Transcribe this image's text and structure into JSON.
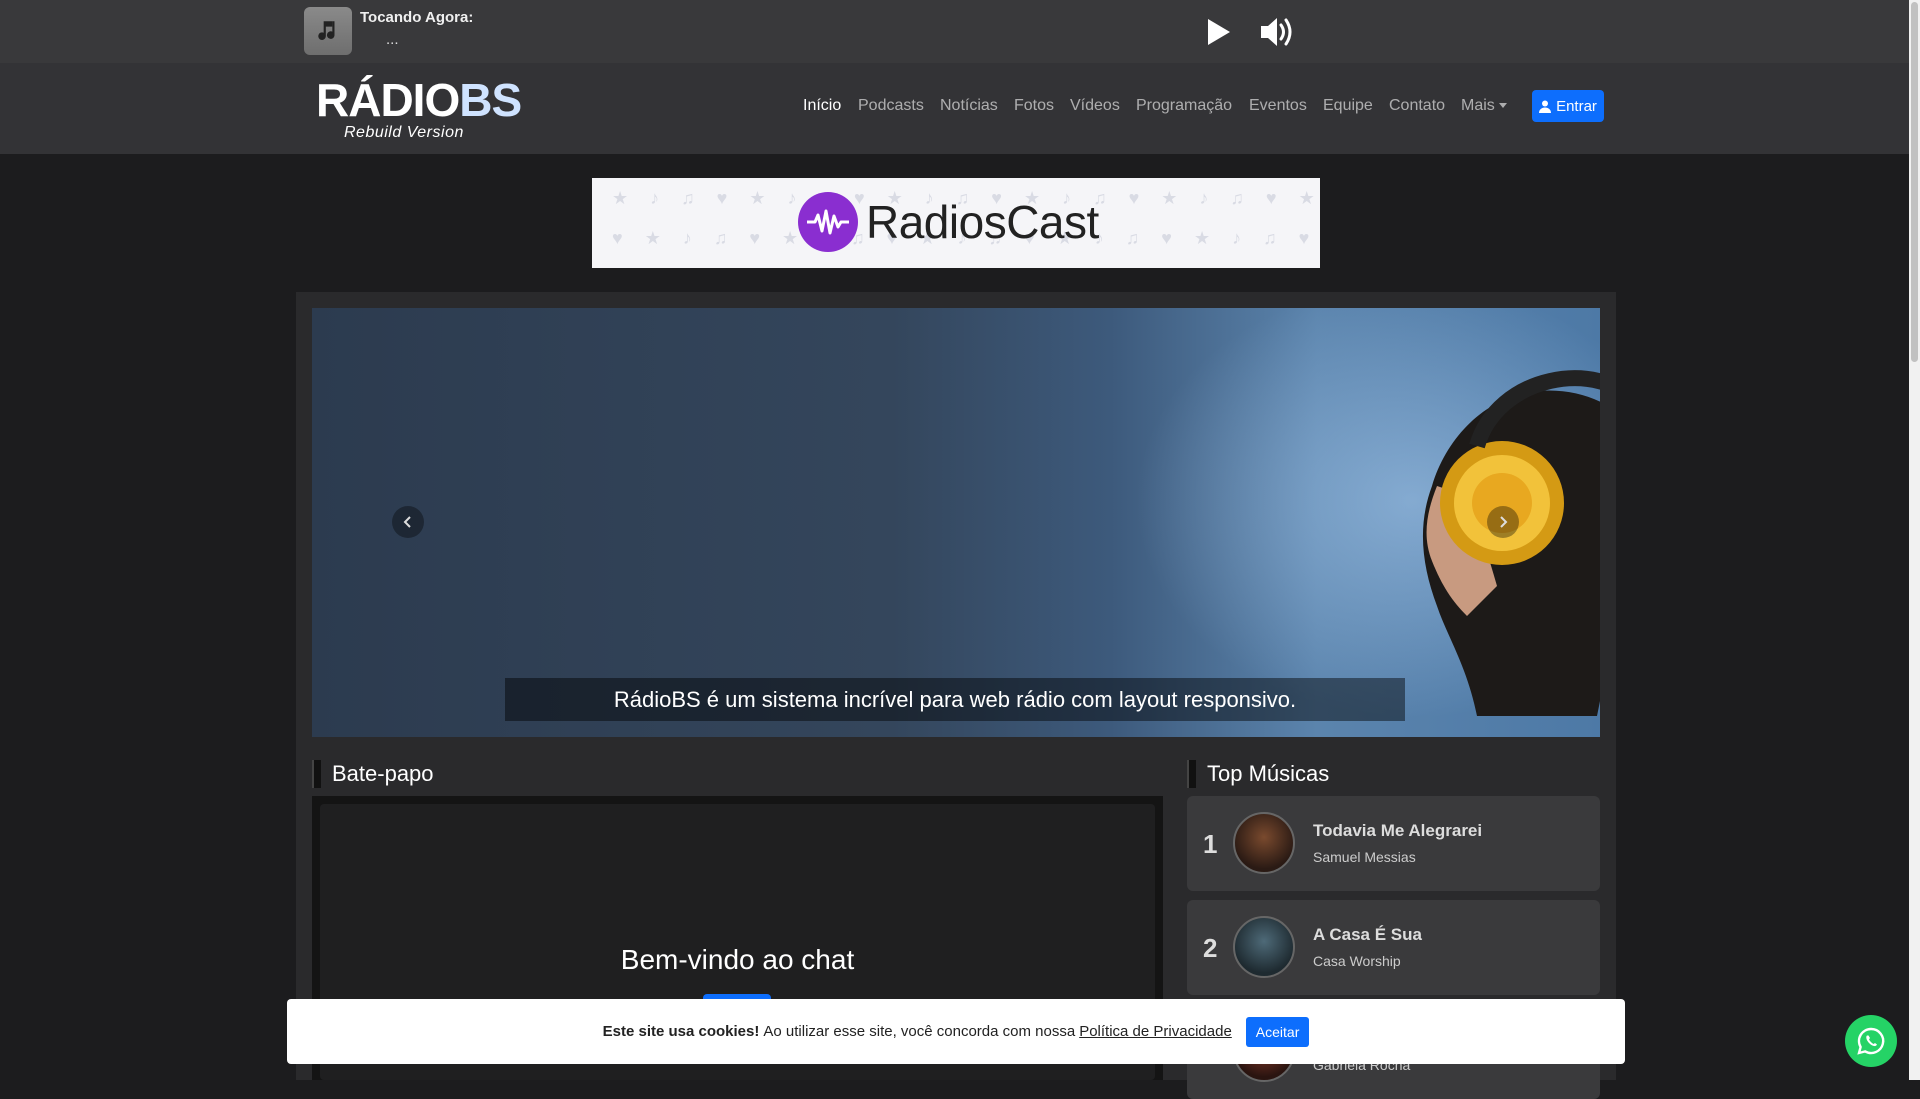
{
  "player": {
    "now_playing_label": "Tocando Agora:",
    "song": "...",
    "icons": [
      "music-note-icon",
      "play-icon",
      "volume-icon"
    ]
  },
  "navbar": {
    "logo_brand_part1": "RÁDIO",
    "logo_brand_part2": "BS",
    "logo_tagline": "Rebuild Version",
    "items": [
      {
        "label": "Início",
        "active": true
      },
      {
        "label": "Podcasts"
      },
      {
        "label": "Notícias"
      },
      {
        "label": "Fotos"
      },
      {
        "label": "Vídeos"
      },
      {
        "label": "Programação"
      },
      {
        "label": "Eventos"
      },
      {
        "label": "Equipe"
      },
      {
        "label": "Contato"
      },
      {
        "label": "Mais"
      }
    ],
    "login_label": "Entrar"
  },
  "ad": {
    "brand": "RadiosCast"
  },
  "slider": {
    "caption": "RádioBS é um sistema incrível para web rádio com layout responsivo."
  },
  "chat": {
    "title": "Bate-papo",
    "welcome": "Bem-vindo ao chat"
  },
  "top_songs": {
    "title": "Top Músicas",
    "items": [
      {
        "rank": "1",
        "name": "Todavia Me Alegrarei",
        "artist": "Samuel Messias"
      },
      {
        "rank": "2",
        "name": "A Casa É Sua",
        "artist": "Casa Worship"
      },
      {
        "rank": "3",
        "name": "",
        "artist": "Gabriela Rocha"
      }
    ]
  },
  "cookies": {
    "bold": "Este site usa cookies!",
    "text": "Ao utilizar esse site, você concorda com nossa",
    "link": "Política de Privacidade",
    "accept": "Aceitar"
  },
  "colors": {
    "primary": "#0d6efd",
    "background": "#1c1c1e",
    "whatsapp": "#25d366"
  }
}
